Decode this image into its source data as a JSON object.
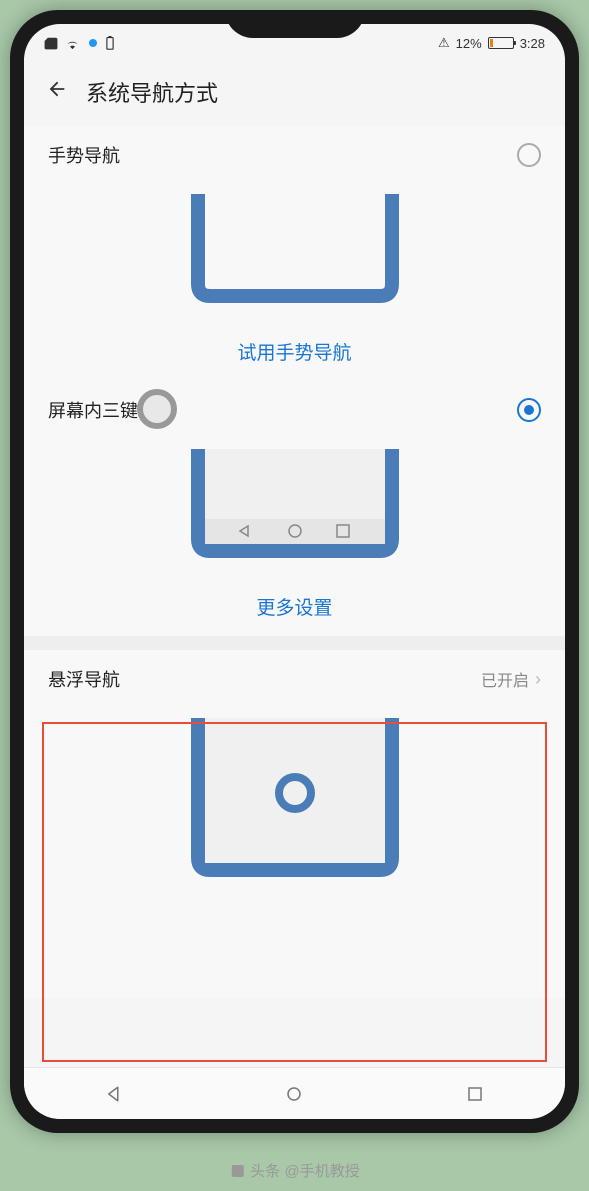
{
  "status_bar": {
    "battery_pct": "12%",
    "time": "3:28"
  },
  "header": {
    "title": "系统导航方式"
  },
  "options": {
    "gesture": {
      "label": "手势导航",
      "action_link": "试用手势导航",
      "selected": false
    },
    "three_key": {
      "label": "屏幕内三键导航",
      "action_link": "更多设置",
      "selected": true
    },
    "floating": {
      "label": "悬浮导航",
      "status": "已开启"
    }
  },
  "watermark": "头条 @手机教授"
}
